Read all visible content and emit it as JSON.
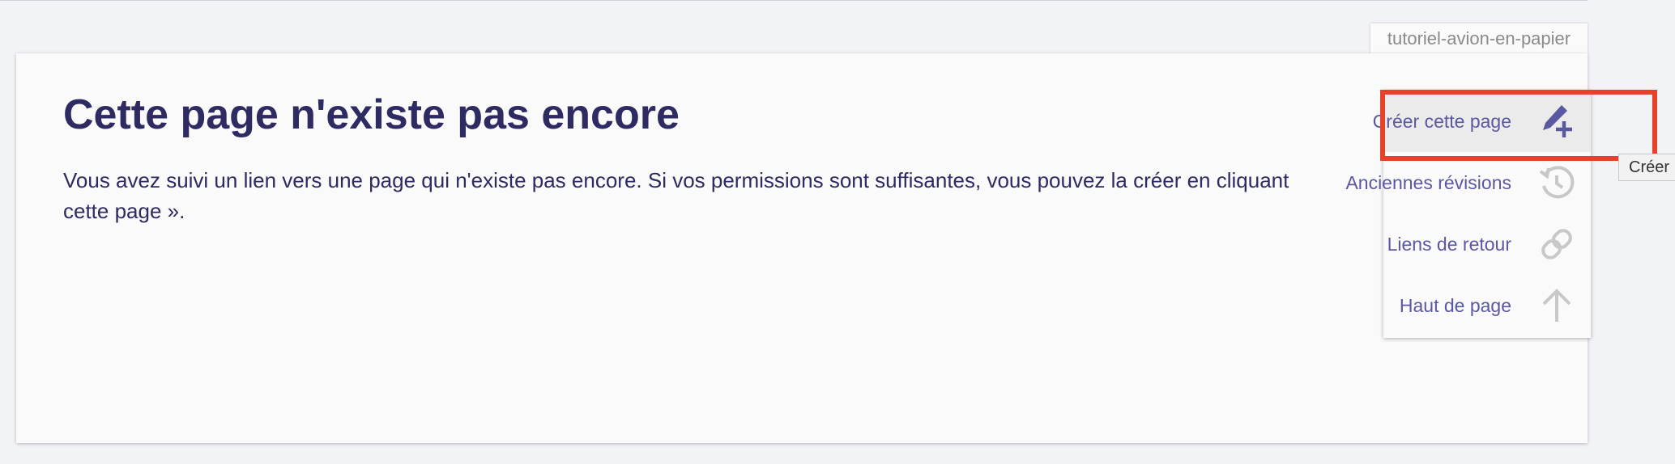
{
  "page": {
    "id": "tutoriel-avion-en-papier",
    "title": "Cette page n'existe pas encore",
    "message_line1": "Vous avez suivi un lien vers une page qui n'existe pas encore. Si vos permissions sont suffisantes, vous pouvez la créer en cliquant",
    "message_line2": "cette page »."
  },
  "tools": {
    "create": "Créer cette page",
    "revisions": "Anciennes révisions",
    "backlinks": "Liens de retour",
    "top": "Haut de page"
  },
  "tooltip": "Créer",
  "colors": {
    "highlight": "#e8402a",
    "link": "#5a58a0",
    "text": "#2e2a62"
  },
  "icons": {
    "create": "pencil-plus-icon",
    "revisions": "history-icon",
    "backlinks": "link-icon",
    "top": "arrow-up-icon"
  }
}
